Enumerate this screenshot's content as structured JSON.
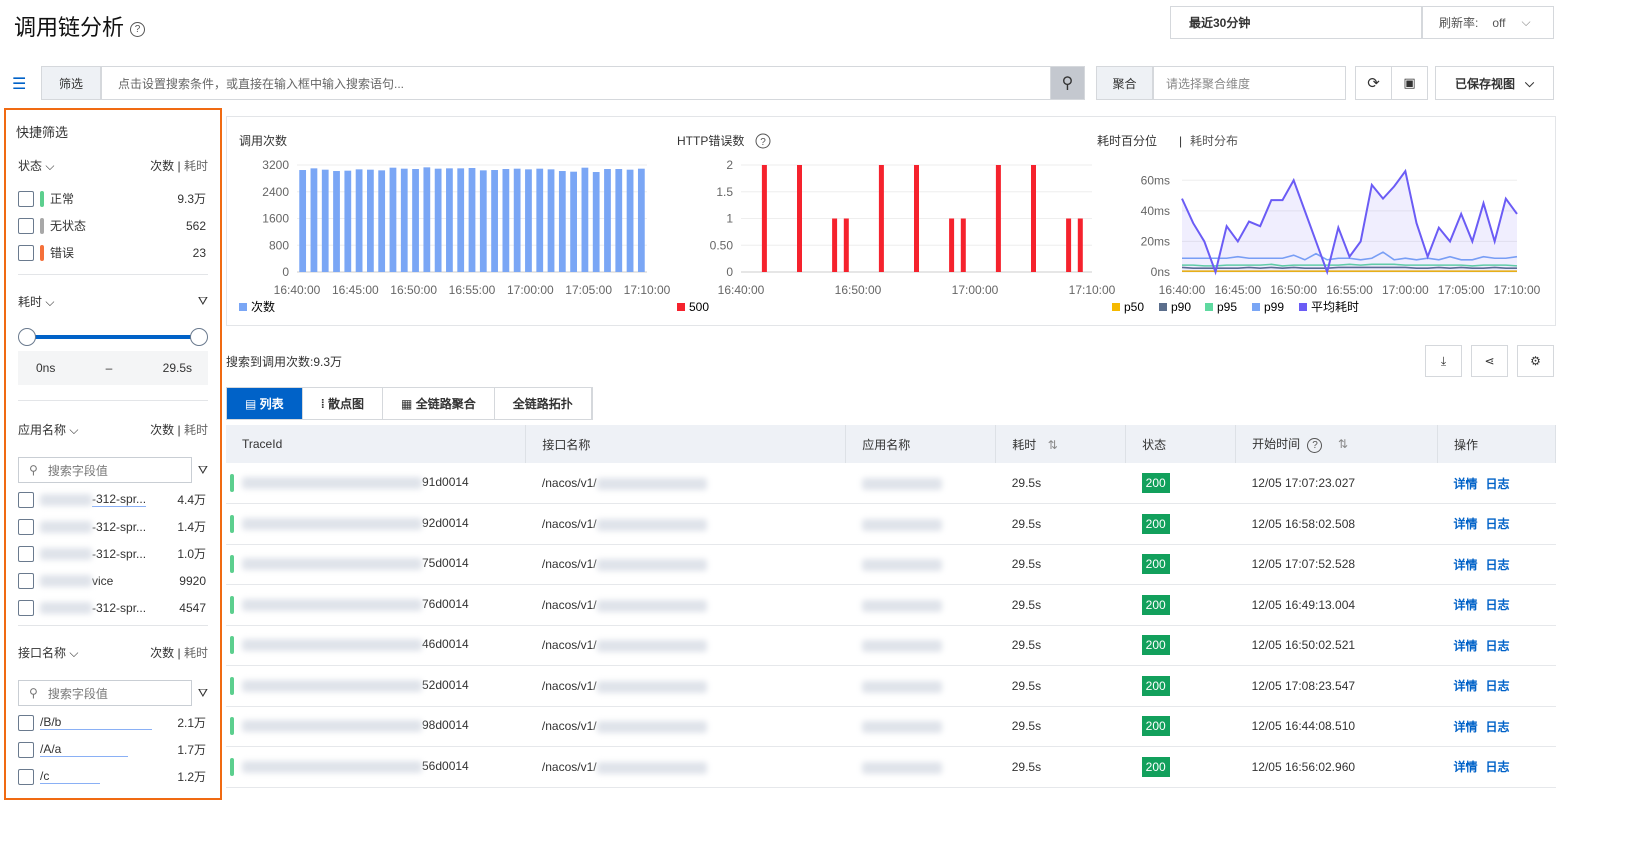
{
  "header": {
    "title": "调用链分析",
    "help_icon": "question-circle-icon",
    "time_range": "最近30分钟",
    "refresh_label": "刷新率:",
    "refresh_value": "off"
  },
  "search": {
    "filter_label": "筛选",
    "placeholder": "点击设置搜索条件，或直接在输入框中输入搜索语句...",
    "agg_label": "聚合",
    "agg_placeholder": "请选择聚合维度",
    "saved_views": "已保存视图"
  },
  "quick_filter": {
    "title": "快捷筛选",
    "count_label": "次数",
    "time_label": "耗时",
    "status": {
      "label": "状态",
      "items": [
        {
          "label": "正常",
          "count": "9.3万",
          "color": "#5ccf8e"
        },
        {
          "label": "无状态",
          "count": "562",
          "color": "#a8a8a8"
        },
        {
          "label": "错误",
          "count": "23",
          "color": "#f5703a"
        }
      ]
    },
    "duration": {
      "label": "耗时",
      "min": "0ns",
      "dash": "–",
      "max": "29.5s",
      "range_fraction": [
        0,
        1
      ]
    },
    "app": {
      "label": "应用名称",
      "search_placeholder": "搜索字段值",
      "items": [
        {
          "label": "-312-spr...",
          "count": "4.4万"
        },
        {
          "label": "-312-spr...",
          "count": "1.4万"
        },
        {
          "label": "-312-spr...",
          "count": "1.0万"
        },
        {
          "label": "vice",
          "count": "9920"
        },
        {
          "label": "-312-spr...",
          "count": "4547"
        }
      ]
    },
    "api": {
      "label": "接口名称",
      "search_placeholder": "搜索字段值",
      "items": [
        {
          "label": "/B/b",
          "count": "2.1万"
        },
        {
          "label": "/A/a",
          "count": "1.7万"
        },
        {
          "label": "/c",
          "count": "1.2万"
        }
      ]
    }
  },
  "chart_data": [
    {
      "type": "bar",
      "title": "调用次数",
      "legend": [
        "次数"
      ],
      "color": "#7aa6f5",
      "ylim": [
        0,
        3200
      ],
      "yticks": [
        "0",
        "800",
        "1600",
        "2400",
        "3200"
      ],
      "xticks": [
        "16:40:00",
        "16:45:00",
        "16:50:00",
        "16:55:00",
        "17:00:00",
        "17:05:00",
        "17:10:00"
      ],
      "values": [
        3050,
        3100,
        3060,
        3020,
        3030,
        3070,
        3060,
        3040,
        3120,
        3090,
        3080,
        3130,
        3090,
        3100,
        3100,
        3110,
        3040,
        3050,
        3080,
        3090,
        3070,
        3090,
        3070,
        3020,
        3000,
        3120,
        2990,
        3080,
        3080,
        3060,
        3090
      ]
    },
    {
      "type": "bar",
      "title": "HTTP错误数",
      "legend": [
        "500"
      ],
      "color": "#f5222d",
      "ylim": [
        0,
        2
      ],
      "yticks": [
        "0",
        "0.50",
        "1",
        "1.5",
        "2"
      ],
      "xticks": [
        "16:40:00",
        "16:50:00",
        "17:00:00",
        "17:10:00"
      ],
      "x": [
        "16:42",
        "16:45",
        "16:48",
        "16:49",
        "16:52",
        "16:55",
        "16:58",
        "16:59",
        "17:02",
        "17:05",
        "17:08",
        "17:09"
      ],
      "values": [
        2,
        2,
        1,
        1,
        2,
        2,
        1,
        1,
        2,
        2,
        1,
        1
      ]
    },
    {
      "type": "line",
      "title": "耗时百分位",
      "title2": "耗时分布",
      "ylim": [
        0,
        70
      ],
      "yticks": [
        "0ns",
        "20ms",
        "40ms",
        "60ms"
      ],
      "xticks": [
        "16:40:00",
        "16:45:00",
        "16:50:00",
        "16:55:00",
        "17:00:00",
        "17:05:00",
        "17:10:00"
      ],
      "series": [
        {
          "name": "p50",
          "color": "#f5b900",
          "values": [
            0.5,
            0.5,
            0.5,
            0.5,
            0.5,
            0.5,
            0.5,
            0.5,
            0.5,
            0.5,
            0.5,
            0.5,
            0.5,
            0.5,
            0.5,
            0.5,
            0.5,
            0.5,
            0.5,
            0.5,
            0.5,
            0.5,
            0.5,
            0.5,
            0.5,
            0.5,
            0.5,
            0.5,
            0.5,
            0.5,
            0.5
          ]
        },
        {
          "name": "p90",
          "color": "#5b6e8c",
          "values": [
            3,
            2.5,
            2.5,
            2.5,
            2.5,
            2.5,
            3,
            2.5,
            3,
            2.5,
            3,
            2.5,
            2.5,
            2.5,
            3,
            3,
            3,
            3,
            3,
            3,
            3,
            2.5,
            2.5,
            3,
            2.5,
            3,
            2.5,
            2.5,
            3,
            2.5,
            2.5
          ]
        },
        {
          "name": "p95",
          "color": "#5fd9a0",
          "values": [
            4.5,
            4.5,
            4,
            4,
            4.5,
            4.5,
            4.5,
            4.5,
            5,
            4,
            4.5,
            4.5,
            4.5,
            4.5,
            4.5,
            5,
            4.5,
            5,
            5,
            5,
            4.5,
            4.5,
            4.5,
            4.5,
            4.5,
            4.5,
            4,
            4.5,
            4.5,
            4.5,
            4
          ]
        },
        {
          "name": "p99",
          "color": "#7aa6f5",
          "values": [
            9,
            9,
            9,
            9,
            9,
            10,
            9,
            9,
            9,
            9,
            11,
            8,
            12,
            8,
            9,
            9,
            8,
            9,
            13,
            8,
            9,
            8,
            9,
            8,
            10,
            8,
            8,
            10,
            9,
            9,
            10
          ]
        },
        {
          "name": "平均耗时",
          "color": "#6b5cf5",
          "values": [
            48,
            32,
            20,
            0,
            30,
            20,
            33,
            30,
            47,
            47,
            60,
            40,
            20,
            0,
            29,
            10,
            20,
            57,
            48,
            56,
            66,
            32,
            10,
            29,
            20,
            38,
            20,
            45,
            20,
            48,
            38
          ]
        }
      ]
    }
  ],
  "results": {
    "summary": "搜索到调用次数:9.3万",
    "tabs": [
      "列表",
      "散点图",
      "全链路聚合",
      "全链路拓扑"
    ]
  },
  "table": {
    "columns": [
      "TraceId",
      "接口名称",
      "应用名称",
      "耗时",
      "状态",
      "开始时间",
      "操作"
    ],
    "actions": [
      "详情",
      "日志"
    ],
    "rows": [
      {
        "trace": "91d0014",
        "api": "/nacos/v1/",
        "dur": "29.5s",
        "status": "200",
        "time": "12/05 17:07:23.027"
      },
      {
        "trace": "92d0014",
        "api": "/nacos/v1/",
        "dur": "29.5s",
        "status": "200",
        "time": "12/05 16:58:02.508"
      },
      {
        "trace": "75d0014",
        "api": "/nacos/v1/",
        "dur": "29.5s",
        "status": "200",
        "time": "12/05 17:07:52.528"
      },
      {
        "trace": "76d0014",
        "api": "/nacos/v1/",
        "dur": "29.5s",
        "status": "200",
        "time": "12/05 16:49:13.004"
      },
      {
        "trace": "46d0014",
        "api": "/nacos/v1/",
        "dur": "29.5s",
        "status": "200",
        "time": "12/05 16:50:02.521"
      },
      {
        "trace": "52d0014",
        "api": "/nacos/v1/",
        "dur": "29.5s",
        "status": "200",
        "time": "12/05 17:08:23.547"
      },
      {
        "trace": "98d0014",
        "api": "/nacos/v1/",
        "dur": "29.5s",
        "status": "200",
        "time": "12/05 16:44:08.510"
      },
      {
        "trace": "56d0014",
        "api": "/nacos/v1/",
        "dur": "29.5s",
        "status": "200",
        "time": "12/05 16:56:02.960"
      }
    ]
  }
}
